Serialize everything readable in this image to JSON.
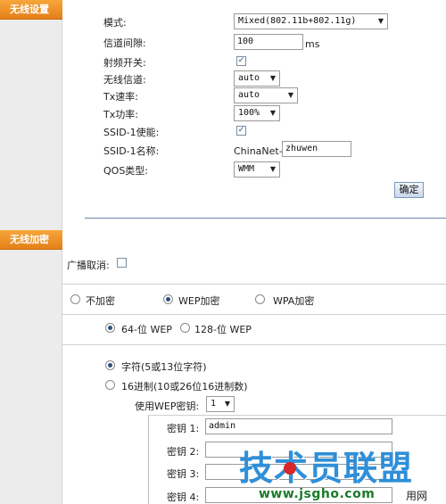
{
  "sidebar": {
    "wireless_settings": "无线设置",
    "wireless_encryption": "无线加密"
  },
  "wireless": {
    "mode_label": "模式:",
    "mode_value": "Mixed(802.11b+802.11g)",
    "beacon_label": "信道间隙:",
    "beacon_value": "100",
    "beacon_unit": "ms",
    "radio_label": "射频开关:",
    "radio_checked": true,
    "channel_label": "无线信道:",
    "channel_value": "auto",
    "tx_rate_label": "Tx速率:",
    "tx_rate_value": "auto",
    "tx_power_label": "Tx功率:",
    "tx_power_value": "100%",
    "ssid_enable_label": "SSID-1使能:",
    "ssid_enable_checked": true,
    "ssid_name_label": "SSID-1名称:",
    "ssid_prefix": "ChinaNet-",
    "ssid_value": "zhuwen",
    "qos_label": "QOS类型:",
    "qos_value": "WMM",
    "confirm_button": "确定"
  },
  "encryption": {
    "broadcast_label": "广播取消:",
    "broadcast_checked": false,
    "options": [
      {
        "label": "不加密",
        "selected": false
      },
      {
        "label": "WEP加密",
        "selected": true
      },
      {
        "label": "WPA加密",
        "selected": false
      }
    ],
    "wep_length": [
      {
        "label": "64-位  WEP",
        "selected": true
      },
      {
        "label": "128-位  WEP",
        "selected": false
      }
    ],
    "key_format": [
      {
        "label": "字符(5或13位字符)",
        "selected": true
      },
      {
        "label": "16进制(10或26位16进制数)",
        "selected": false
      }
    ],
    "use_key_label": "使用WEP密钥:",
    "use_key_value": "1",
    "keys": [
      {
        "label": "密钥  1:",
        "value": "admin"
      },
      {
        "label": "密钥  2:",
        "value": ""
      },
      {
        "label": "密钥  3:",
        "value": ""
      },
      {
        "label": "密钥  4:",
        "value": ""
      }
    ]
  },
  "watermark": {
    "brand": "技术员联盟",
    "url": "www.jsgho.com",
    "trailing_text": "用网"
  },
  "colors": {
    "section_header": "#f0921f",
    "sidebar": "#ececec",
    "divider": "#6f86a8",
    "watermark_blue": "#2f8fd8",
    "watermark_green": "#1b7a2a"
  }
}
